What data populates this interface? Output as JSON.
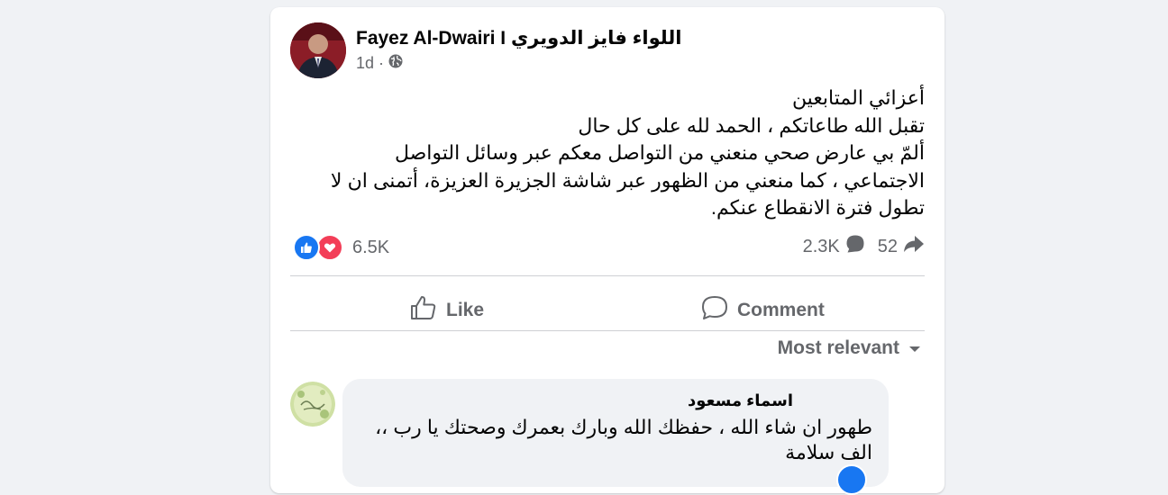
{
  "post": {
    "author": "Fayez Al-Dwairi I اللواء فايز الدويري",
    "time": "1d",
    "privacy_icon": "globe-icon",
    "text_lines": [
      "أعزائي المتابعين",
      "تقبل الله طاعاتكم ، الحمد لله على كل حال",
      "ألمّ بي  عارض صحي منعني من التواصل معكم عبر وسائل التواصل",
      "الاجتماعي ، كما منعني من الظهور عبر شاشة الجزيرة العزيزة، أتمنى ان لا",
      "تطول فترة الانقطاع  عنكم."
    ]
  },
  "stats": {
    "reactions_count": "6.5K",
    "reaction_icons": [
      "like-icon",
      "love-icon"
    ],
    "comments_count": "2.3K",
    "shares_count": "52"
  },
  "actions": {
    "like_label": "Like",
    "comment_label": "Comment"
  },
  "comments": {
    "sort_label": "Most relevant",
    "items": [
      {
        "author": "اسماء مسعود",
        "text_lines": [
          "طهور ان شاء الله ، حفظك الله وبارك بعمرك وصحتك يا رب ،،",
          "الف سلامة"
        ]
      }
    ]
  },
  "colors": {
    "background": "#f0f2f5",
    "card": "#ffffff",
    "secondary_text": "#65676b",
    "like_blue": "#1877f2",
    "love_red": "#f33e58"
  }
}
